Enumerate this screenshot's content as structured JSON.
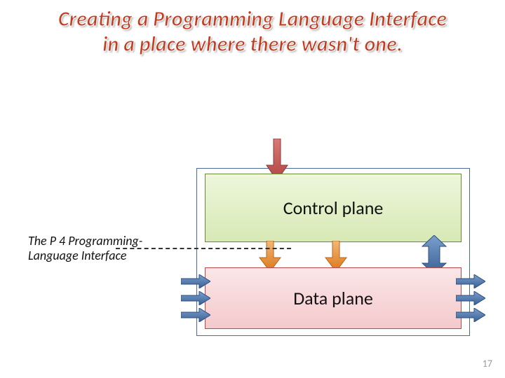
{
  "title": {
    "line1": "Creating a Programming Language Interface",
    "line2": "in a place where there wasn't one."
  },
  "annotation": {
    "p4_caption": "The P 4 Programming-Language Interface"
  },
  "boxes": {
    "control_plane": "Control plane",
    "data_plane": "Data plane"
  },
  "page_number": "17",
  "colors": {
    "title": "#c63a1e",
    "control_fill_top": "#eef6dc",
    "control_fill_bottom": "#d7e9b5",
    "control_border": "#6a8a3a",
    "data_fill_top": "#fbe6e7",
    "data_fill_bottom": "#f4c9cc",
    "data_border": "#b84a4a",
    "arrow_orange": "#e88b2d",
    "arrow_blue": "#3f6aa3",
    "arrow_red": "#c0504d"
  },
  "arrows": {
    "top_down": "arrow-into-control",
    "control_to_data_left": "arrow-control-to-data-1",
    "control_to_data_right": "arrow-control-to-data-2",
    "bidirectional": "arrow-bidirectional",
    "data_in": [
      "arrow-data-in-1",
      "arrow-data-in-2",
      "arrow-data-in-3"
    ],
    "data_out": [
      "arrow-data-out-1",
      "arrow-data-out-2",
      "arrow-data-out-3"
    ]
  }
}
